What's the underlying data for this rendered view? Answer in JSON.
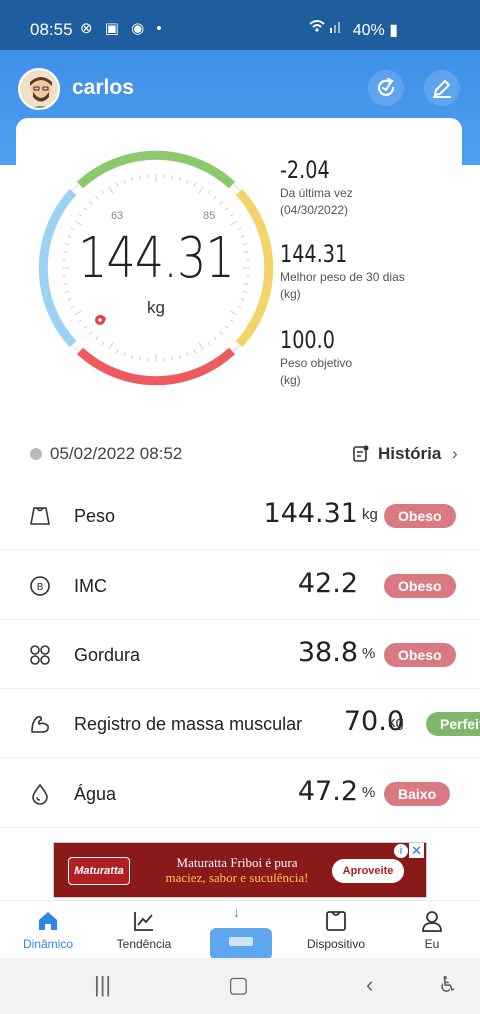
{
  "status": {
    "time": "08:55",
    "icons": "⊗ ▣ ◉ •",
    "battery": "40%"
  },
  "header": {
    "username": "carlos"
  },
  "gauge": {
    "weight": "144.31",
    "unit": "kg",
    "tick_low": "63",
    "tick_high": "85",
    "marker_fraction": 0.05
  },
  "stats": [
    {
      "value": "-2.04",
      "label1": "Da última vez",
      "label2": "(04/30/2022)"
    },
    {
      "value": "144.31",
      "label1": "Melhor peso de 30 dias",
      "label2": "(kg)"
    },
    {
      "value": "100.0",
      "label1": "Peso objetivo",
      "label2": "(kg)"
    }
  ],
  "daterow": {
    "date": "05/02/2022 08:52",
    "history": "História"
  },
  "metrics": [
    {
      "name": "Peso",
      "value": "144.31",
      "unit": "kg",
      "badge": "Obeso",
      "icon": "weight-icon"
    },
    {
      "name": "IMC",
      "value": "42.2",
      "unit": "",
      "badge": "Obeso",
      "icon": "bmi-icon"
    },
    {
      "name": "Gordura",
      "value": "38.8",
      "unit": "%",
      "badge": "Obeso",
      "icon": "fat-icon"
    },
    {
      "name": "Registro de massa muscular",
      "value": "70.0",
      "unit": "kg",
      "badge": "Perfeit",
      "icon": "muscle-icon"
    },
    {
      "name": "Água",
      "value": "47.2",
      "unit": "%",
      "badge": "Baixo",
      "icon": "water-icon"
    }
  ],
  "ad": {
    "logo": "Maturatta",
    "line1": "Maturatta Friboi é pura",
    "line2": "maciez, sabor e suculência!",
    "cta": "Aproveite"
  },
  "nav": [
    {
      "label": "Dinâmico"
    },
    {
      "label": "Tendência"
    },
    {
      "label": "Dispositivo"
    },
    {
      "label": "Eu"
    }
  ],
  "colors": {
    "accent": "#2e86e8",
    "header": "#3e8fe8",
    "obeso": "#d97a82",
    "perfeito": "#7fb86a"
  }
}
